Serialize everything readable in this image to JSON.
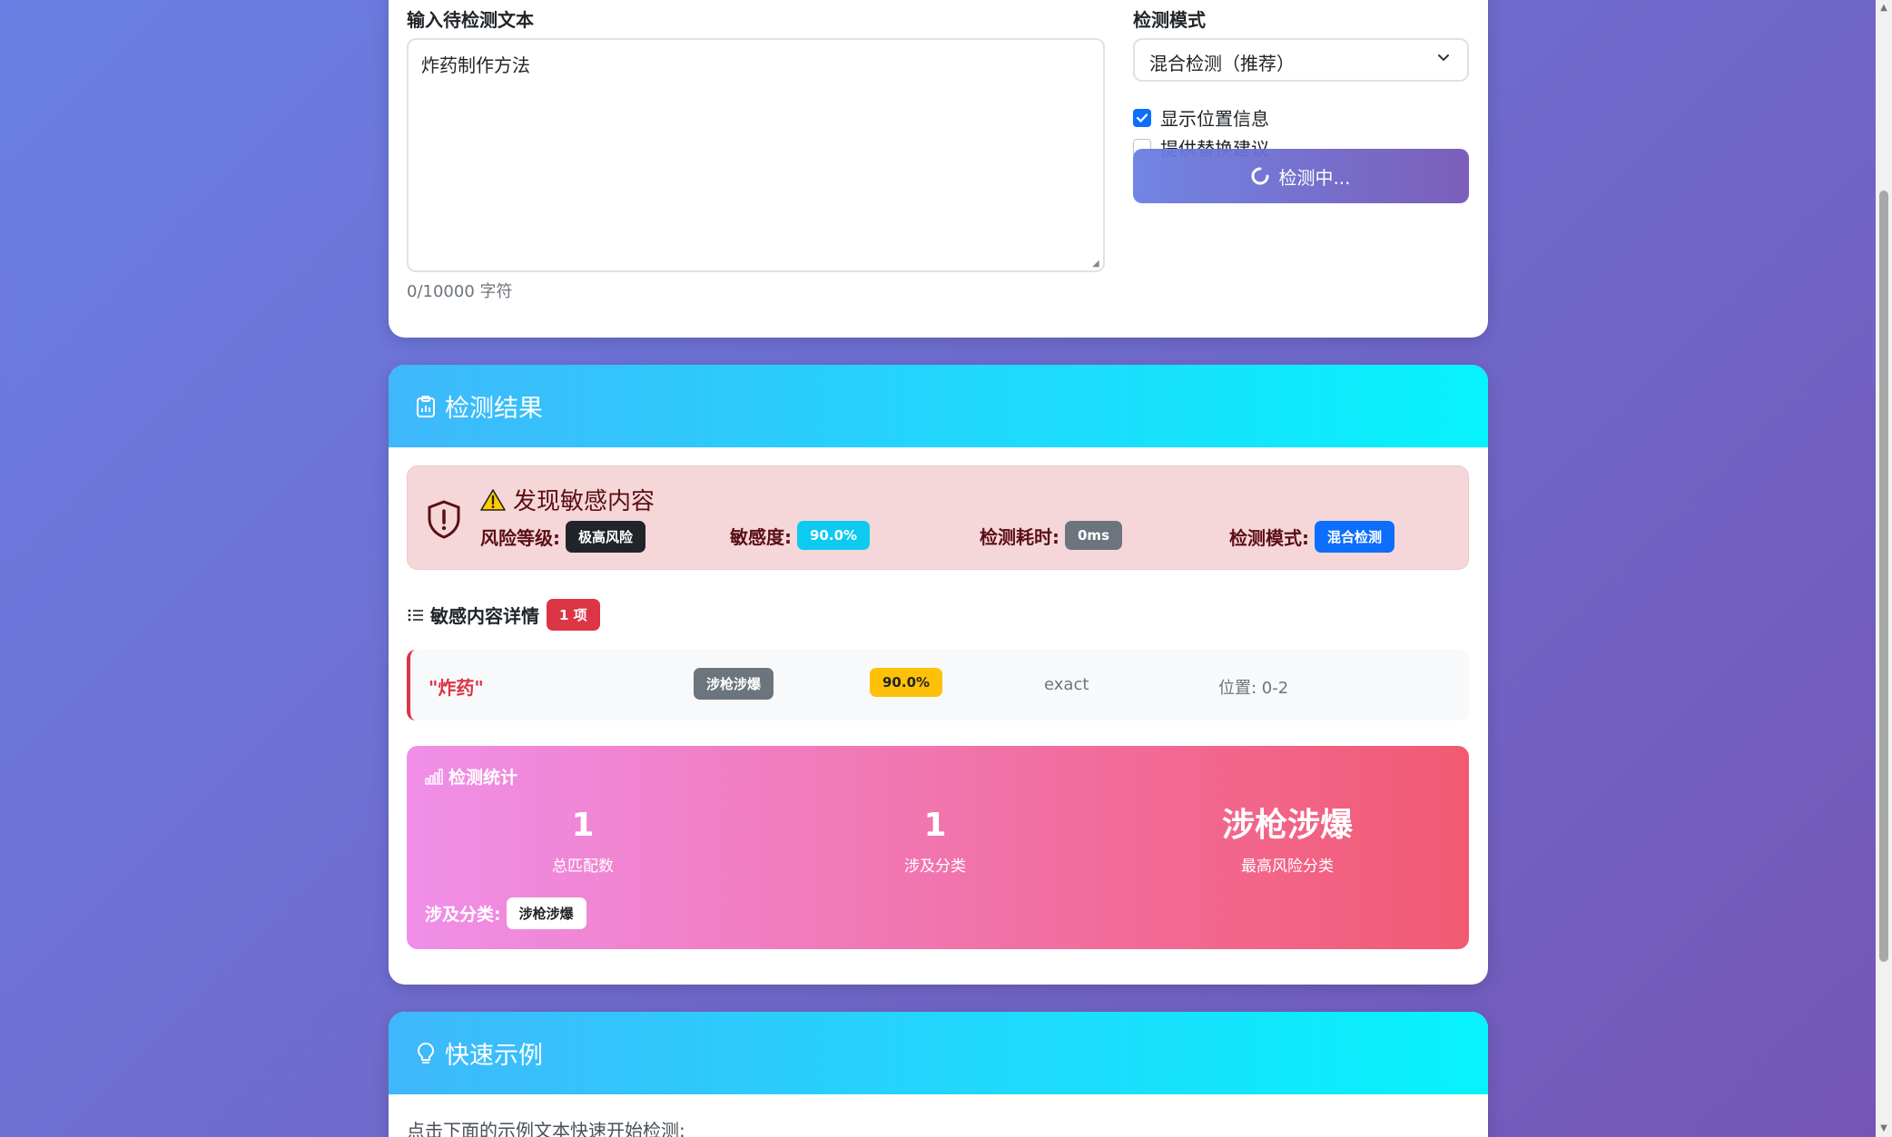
{
  "input": {
    "textarea_label": "输入待检测文本",
    "text_value": "炸药制作方法",
    "char_count": "0/10000 字符",
    "mode_label": "检测模式",
    "mode_selected": "混合检测（推荐）",
    "opt_show_position": {
      "label": "显示位置信息",
      "checked": true
    },
    "opt_suggest": {
      "label": "提供替换建议",
      "checked": false
    },
    "detect_button": "检测中..."
  },
  "result": {
    "header_title": "检测结果",
    "alert_title": "发现敏感内容",
    "risk_label": "风险等级:",
    "risk_value": "极高风险",
    "sensitivity_label": "敏感度:",
    "sensitivity_value": "90.0%",
    "time_label": "检测耗时:",
    "time_value": "0ms",
    "mode_label": "检测模式:",
    "mode_value": "混合检测",
    "detail_title": "敏感内容详情",
    "detail_count": "1 项",
    "matches": [
      {
        "word": "\"炸药\"",
        "category": "涉枪涉爆",
        "confidence": "90.0%",
        "match_type": "exact",
        "position": "位置: 0-2"
      }
    ],
    "stats": {
      "title": "检测统计",
      "total_matches": "1",
      "total_matches_label": "总匹配数",
      "categories_count": "1",
      "categories_count_label": "涉及分类",
      "top_category": "涉枪涉爆",
      "top_category_label": "最高风险分类",
      "categories_label": "涉及分类:",
      "categories": [
        "涉枪涉爆"
      ]
    }
  },
  "examples": {
    "header_title": "快速示例",
    "subtitle": "点击下面的示例文本快速开始检测:"
  },
  "colors": {
    "accent_gradient_start": "#6a7fe3",
    "accent_gradient_end": "#7456b6",
    "header_gradient_start": "#3fb8fb",
    "header_gradient_end": "#06f3fc",
    "danger": "#dc3545",
    "stats_gradient_start": "#f08fe9",
    "stats_gradient_end": "#f25a72"
  }
}
